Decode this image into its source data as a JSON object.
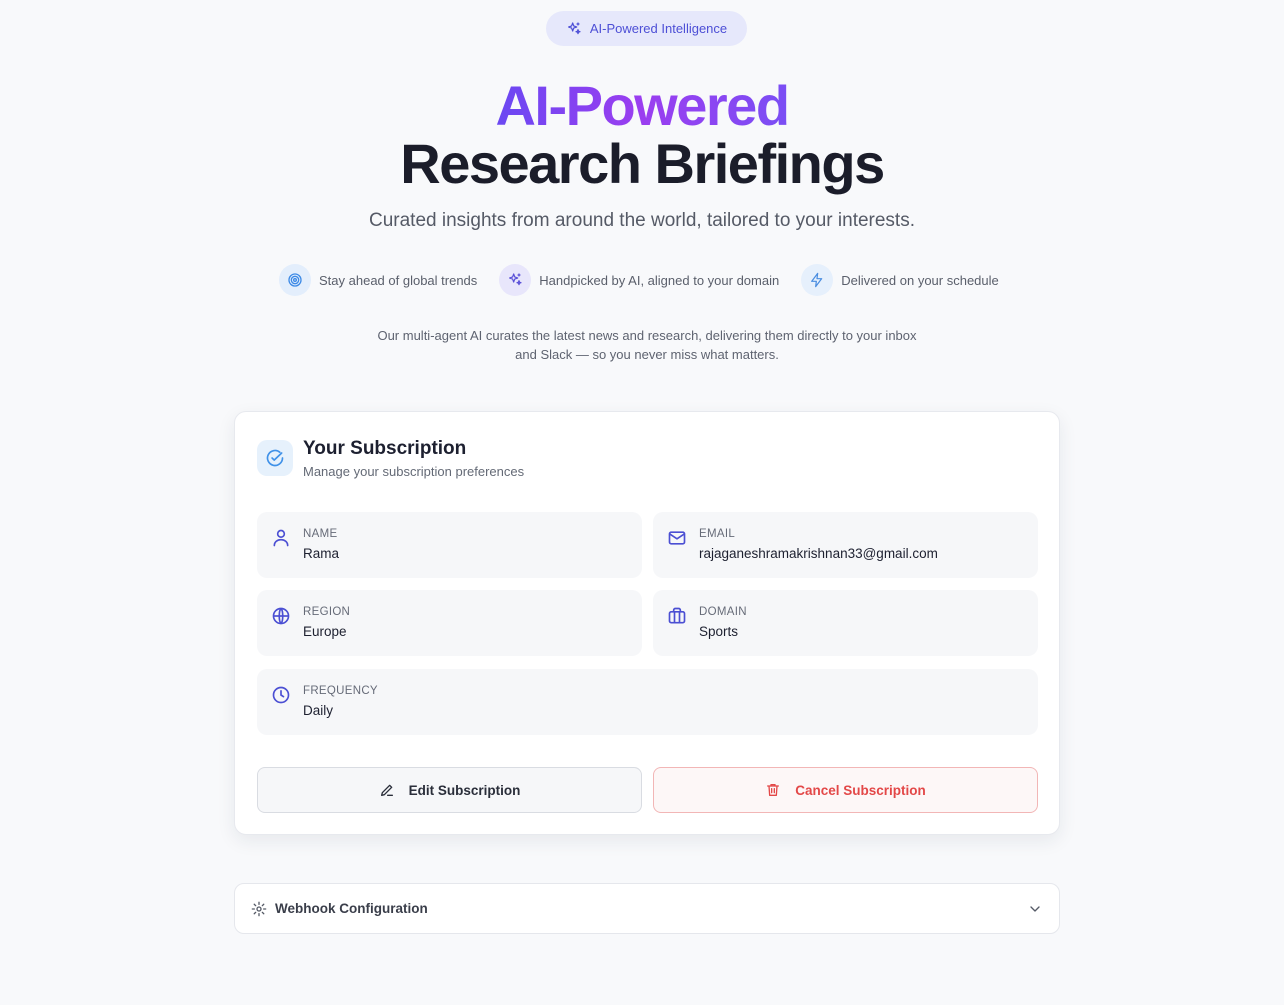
{
  "badge": {
    "label": "AI-Powered Intelligence",
    "icon": "sparkles-icon"
  },
  "hero": {
    "line1": "AI-Powered",
    "line2": "Research Briefings",
    "subtitle": "Curated insights from around the world, tailored to your interests."
  },
  "features": [
    {
      "icon": "target-icon",
      "label": "Stay ahead of global trends"
    },
    {
      "icon": "sparkles-icon",
      "label": "Handpicked by AI, aligned to your domain"
    },
    {
      "icon": "lightning-icon",
      "label": "Delivered on your schedule"
    }
  ],
  "description": "Our multi-agent AI curates the latest news and research, delivering them directly to your inbox and Slack — so you never miss what matters.",
  "subscription": {
    "title": "Your Subscription",
    "subtitle": "Manage your subscription preferences",
    "fields": {
      "name": {
        "label": "NAME",
        "value": "Rama"
      },
      "email": {
        "label": "EMAIL",
        "value": "rajaganeshramakrishnan33@gmail.com"
      },
      "region": {
        "label": "REGION",
        "value": "Europe"
      },
      "domain": {
        "label": "DOMAIN",
        "value": "Sports"
      },
      "frequency": {
        "label": "FREQUENCY",
        "value": "Daily"
      }
    },
    "edit_label": "Edit Subscription",
    "cancel_label": "Cancel Subscription"
  },
  "webhook": {
    "label": "Webhook Configuration"
  },
  "colors": {
    "accent": "#4d4fd6",
    "gradient_start": "#6a48f2",
    "gradient_end": "#9b3ef0",
    "danger": "#e34848",
    "background": "#f8f9fb"
  }
}
